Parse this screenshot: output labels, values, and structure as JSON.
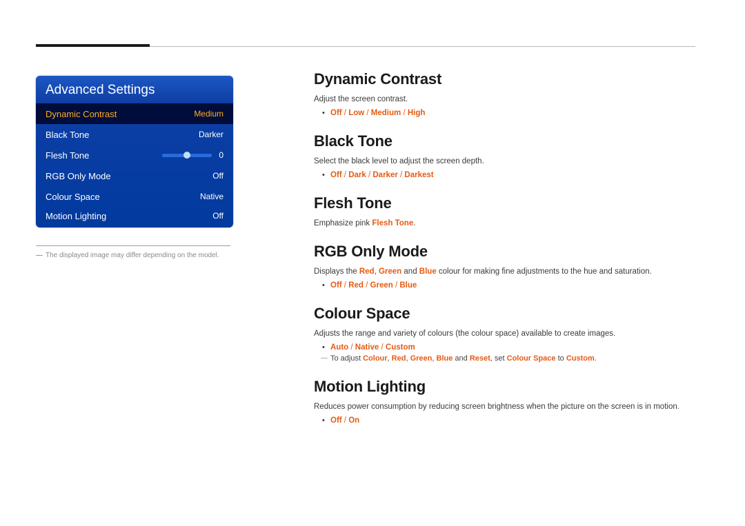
{
  "accent_color": "#e65a12",
  "osd": {
    "title": "Advanced Settings",
    "rows": [
      {
        "label": "Dynamic Contrast",
        "value": "Medium",
        "selected": true
      },
      {
        "label": "Black Tone",
        "value": "Darker"
      },
      {
        "label": "Flesh Tone",
        "value": "0",
        "slider": true
      },
      {
        "label": "RGB Only Mode",
        "value": "Off"
      },
      {
        "label": "Colour Space",
        "value": "Native"
      },
      {
        "label": "Motion Lighting",
        "value": "Off"
      }
    ],
    "footnote": "The displayed image may differ depending on the model."
  },
  "sections": {
    "dynamic_contrast": {
      "title": "Dynamic Contrast",
      "desc": "Adjust the screen contrast.",
      "options": [
        "Off",
        "Low",
        "Medium",
        "High"
      ]
    },
    "black_tone": {
      "title": "Black Tone",
      "desc": "Select the black level to adjust the screen depth.",
      "options": [
        "Off",
        "Dark",
        "Darker",
        "Darkest"
      ]
    },
    "flesh_tone": {
      "title": "Flesh Tone",
      "desc_prefix": "Emphasize pink ",
      "desc_highlight": "Flesh Tone",
      "desc_suffix": "."
    },
    "rgb_only": {
      "title": "RGB Only Mode",
      "desc_parts": {
        "p1": "Displays the ",
        "red": "Red",
        "c1": ", ",
        "green": "Green",
        "c2": " and ",
        "blue": "Blue",
        "p2": " colour for making fine adjustments to the hue and saturation."
      },
      "options": [
        "Off",
        "Red",
        "Green",
        "Blue"
      ]
    },
    "colour_space": {
      "title": "Colour Space",
      "desc": "Adjusts the range and variety of colours (the colour space) available to create images.",
      "options": [
        "Auto",
        "Native",
        "Custom"
      ],
      "subnote": {
        "p1": "To adjust ",
        "k1": "Colour",
        "c1": ", ",
        "k2": "Red",
        "c2": ", ",
        "k3": "Green",
        "c3": ", ",
        "k4": "Blue",
        "c4": " and ",
        "k5": "Reset",
        "c5": ", set ",
        "k6": "Colour Space",
        "c6": " to ",
        "k7": "Custom",
        "c7": "."
      }
    },
    "motion_lighting": {
      "title": "Motion Lighting",
      "desc": "Reduces power consumption by reducing screen brightness when the picture on the screen is in motion.",
      "options": [
        "Off",
        "On"
      ]
    }
  }
}
